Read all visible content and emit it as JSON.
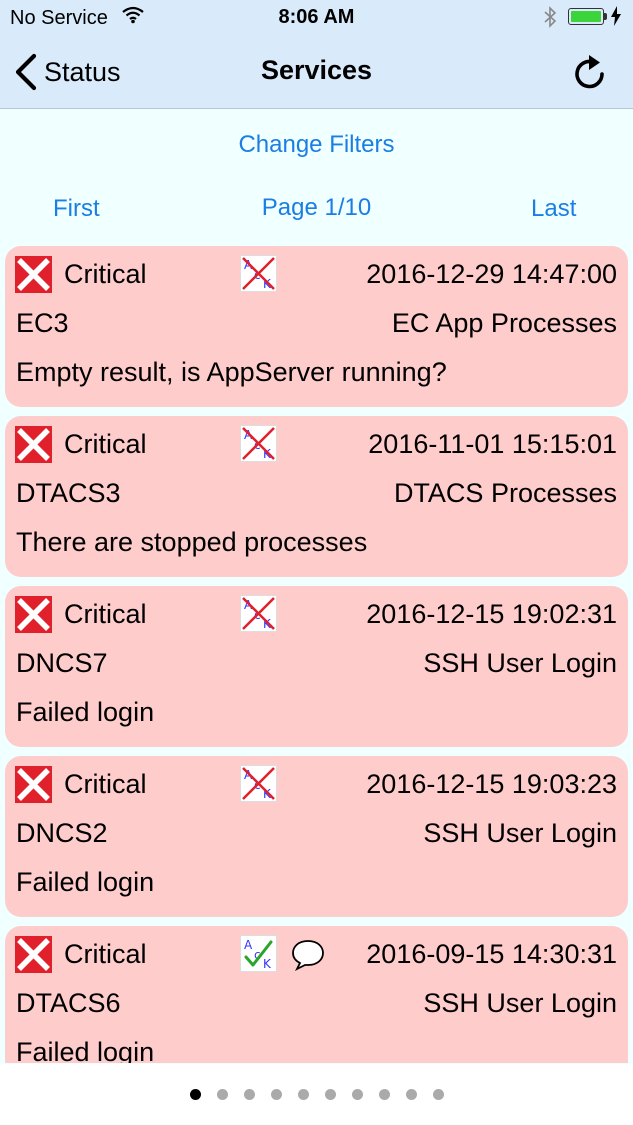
{
  "status_bar": {
    "carrier": "No Service",
    "time": "8:06 AM",
    "battery_level": 1.0,
    "icons": [
      "wifi-icon",
      "bluetooth-icon",
      "battery-icon",
      "charging-bolt-icon"
    ]
  },
  "nav": {
    "back_label": "Status",
    "title": "Services",
    "refresh_icon": "refresh-icon"
  },
  "filters": {
    "change_label": "Change Filters"
  },
  "paging": {
    "first_label": "First",
    "page_label": "Page 1/10",
    "last_label": "Last",
    "page_count": 10,
    "current_page": 1
  },
  "services": [
    {
      "severity": "Critical",
      "date": "2016-12-29 14:47:00",
      "host": "EC3",
      "service": "EC App Processes",
      "message": "Empty result, is AppServer running?",
      "acknowledged": false,
      "has_comment": false
    },
    {
      "severity": "Critical",
      "date": "2016-11-01 15:15:01",
      "host": "DTACS3",
      "service": "DTACS Processes",
      "message": "There are stopped processes",
      "acknowledged": false,
      "has_comment": false
    },
    {
      "severity": "Critical",
      "date": "2016-12-15 19:02:31",
      "host": "DNCS7",
      "service": "SSH User Login",
      "message": "Failed login",
      "acknowledged": false,
      "has_comment": false
    },
    {
      "severity": "Critical",
      "date": "2016-12-15 19:03:23",
      "host": "DNCS2",
      "service": "SSH User Login",
      "message": "Failed login",
      "acknowledged": false,
      "has_comment": false
    },
    {
      "severity": "Critical",
      "date": "2016-09-15 14:30:31",
      "host": "DTACS6",
      "service": "SSH User Login",
      "message": "Failed login",
      "acknowledged": true,
      "has_comment": true
    }
  ],
  "colors": {
    "critical_card": "#ffcccc",
    "critical_icon": "#e0202a",
    "link": "#1a7ee3",
    "nav_background": "#d9eafb",
    "content_background": "#f0ffff"
  }
}
